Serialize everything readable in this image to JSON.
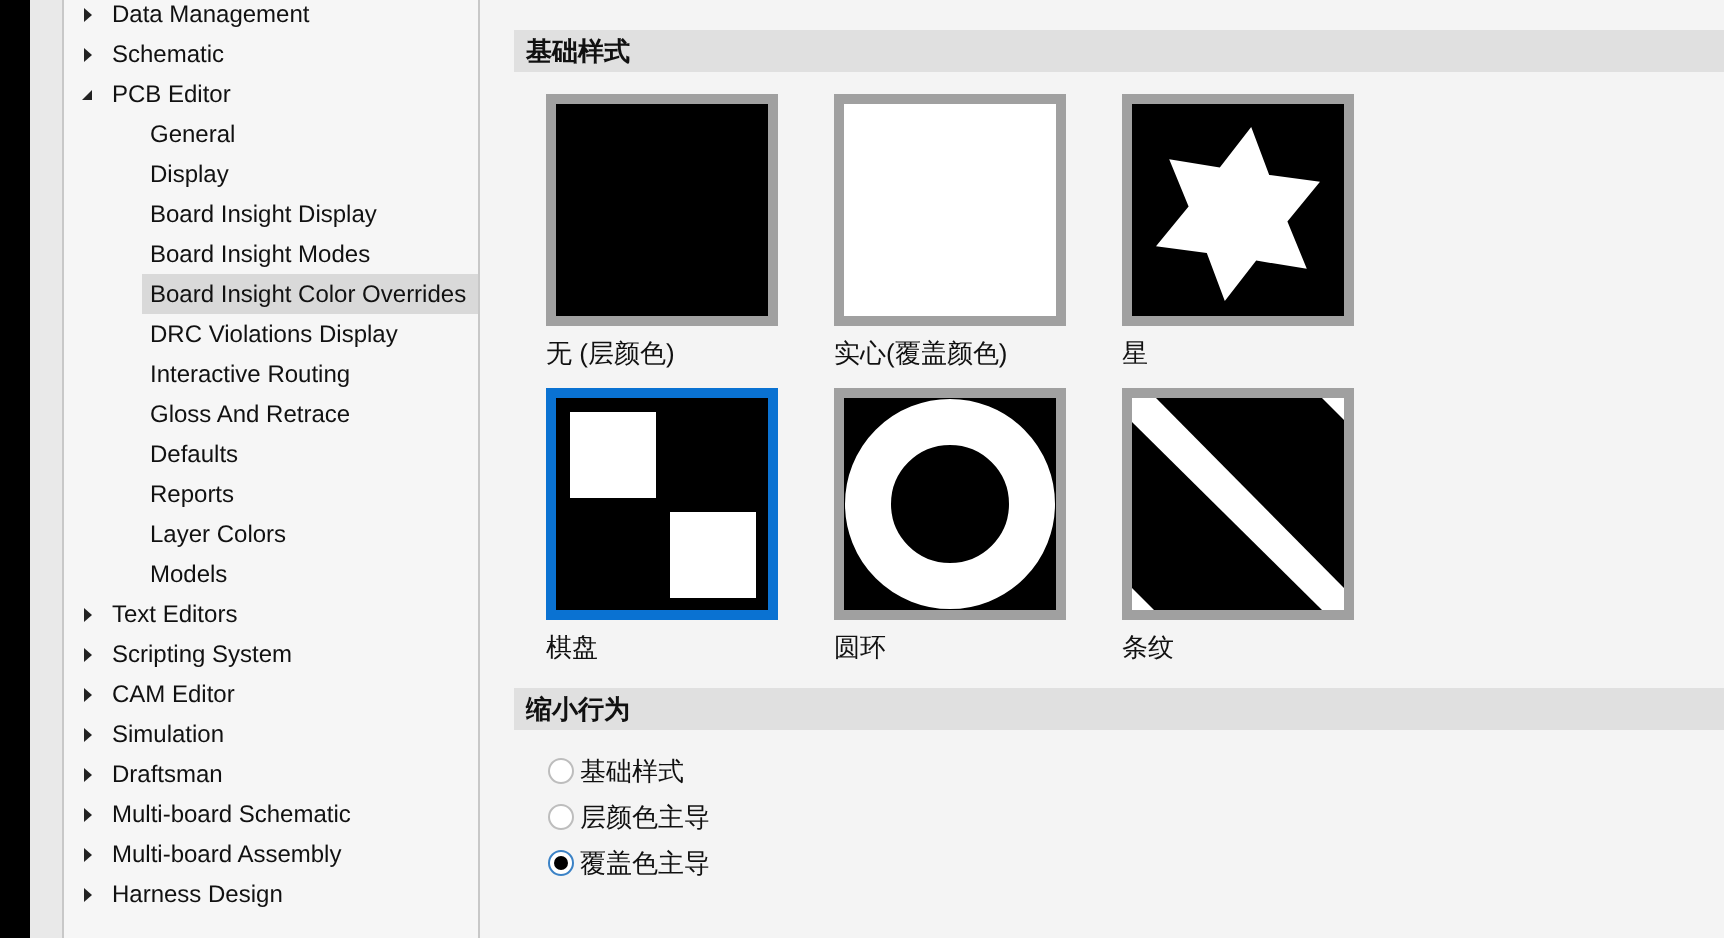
{
  "sidebar": {
    "items": [
      {
        "label": "Data Management",
        "expanded": false,
        "selected": false
      },
      {
        "label": "Schematic",
        "expanded": false,
        "selected": false
      },
      {
        "label": "PCB Editor",
        "expanded": true,
        "selected": false,
        "children": [
          {
            "label": "General",
            "selected": false
          },
          {
            "label": "Display",
            "selected": false
          },
          {
            "label": "Board Insight Display",
            "selected": false
          },
          {
            "label": "Board Insight Modes",
            "selected": false
          },
          {
            "label": "Board Insight Color Overrides",
            "selected": true
          },
          {
            "label": "DRC Violations Display",
            "selected": false
          },
          {
            "label": "Interactive Routing",
            "selected": false
          },
          {
            "label": "Gloss And Retrace",
            "selected": false
          },
          {
            "label": "Defaults",
            "selected": false
          },
          {
            "label": "Reports",
            "selected": false
          },
          {
            "label": "Layer Colors",
            "selected": false
          },
          {
            "label": "Models",
            "selected": false
          }
        ]
      },
      {
        "label": "Text Editors",
        "expanded": false,
        "selected": false
      },
      {
        "label": "Scripting System",
        "expanded": false,
        "selected": false
      },
      {
        "label": "CAM Editor",
        "expanded": false,
        "selected": false
      },
      {
        "label": "Simulation",
        "expanded": false,
        "selected": false
      },
      {
        "label": "Draftsman",
        "expanded": false,
        "selected": false
      },
      {
        "label": "Multi-board Schematic",
        "expanded": false,
        "selected": false
      },
      {
        "label": "Multi-board Assembly",
        "expanded": false,
        "selected": false
      },
      {
        "label": "Harness Design",
        "expanded": false,
        "selected": false
      }
    ]
  },
  "base_styles": {
    "title": "基础样式",
    "styles": [
      {
        "kind": "none",
        "label": "无 (层颜色)",
        "selected": false
      },
      {
        "kind": "solid",
        "label": "实心(覆盖颜色)",
        "selected": false
      },
      {
        "kind": "star",
        "label": "星",
        "selected": false
      },
      {
        "kind": "checker",
        "label": "棋盘",
        "selected": true
      },
      {
        "kind": "ring",
        "label": "圆环",
        "selected": false
      },
      {
        "kind": "stripe",
        "label": "条纹",
        "selected": false
      }
    ]
  },
  "zoom_behavior": {
    "title": "缩小行为",
    "options": [
      {
        "label": "基础样式",
        "checked": false
      },
      {
        "label": "层颜色主导",
        "checked": false
      },
      {
        "label": "覆盖色主导",
        "checked": true
      }
    ]
  }
}
